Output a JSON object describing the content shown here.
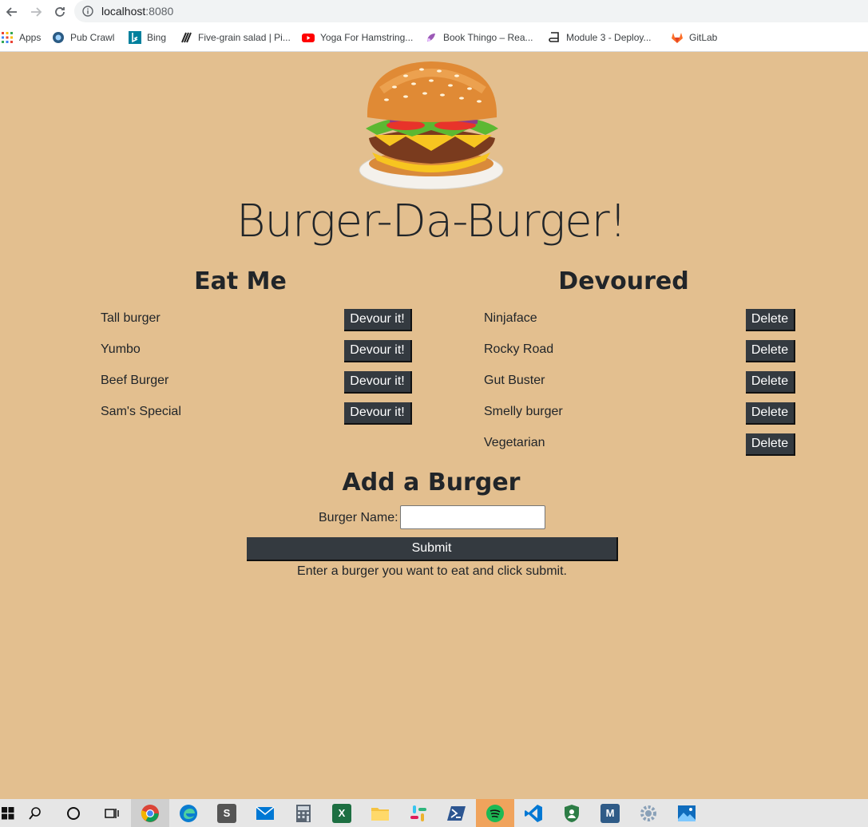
{
  "browser": {
    "url_host": "localhost",
    "url_port": ":8080",
    "bookmarks": [
      {
        "label": "Apps"
      },
      {
        "label": "Pub Crawl"
      },
      {
        "label": "Bing"
      },
      {
        "label": "Five-grain salad | Pi..."
      },
      {
        "label": "Yoga For Hamstring..."
      },
      {
        "label": "Book Thingo – Rea..."
      },
      {
        "label": "Module 3 - Deploy..."
      },
      {
        "label": "GitLab"
      }
    ]
  },
  "page": {
    "title": "Burger-Da-Burger!",
    "eat_me": {
      "heading": "Eat Me",
      "button_label": "Devour it!",
      "items": [
        "Tall burger",
        "Yumbo",
        "Beef Burger",
        "Sam's Special"
      ]
    },
    "devoured": {
      "heading": "Devoured",
      "button_label": "Delete",
      "items": [
        "Ninjaface",
        "Rocky Road",
        "Gut Buster",
        "Smelly burger",
        "Vegetarian"
      ]
    },
    "add_form": {
      "heading": "Add a Burger",
      "field_label": "Burger Name:",
      "field_value": "",
      "submit_label": "Submit",
      "helper_text": "Enter a burger you want to eat and click submit."
    }
  },
  "colors": {
    "page_background": "#e3bf8f",
    "button_background": "#343a40",
    "text": "#212529"
  },
  "taskbar": {
    "apps": [
      "start-icon",
      "search-icon",
      "cortana-icon",
      "task-view-icon",
      "chrome-icon",
      "edge-icon",
      "scrivener-icon",
      "mail-icon",
      "calculator-icon",
      "excel-icon",
      "file-explorer-icon",
      "slack-icon",
      "powershell-icon",
      "spotify-icon",
      "vscode-icon",
      "security-icon",
      "mysql-icon",
      "settings-icon",
      "photos-icon"
    ]
  }
}
